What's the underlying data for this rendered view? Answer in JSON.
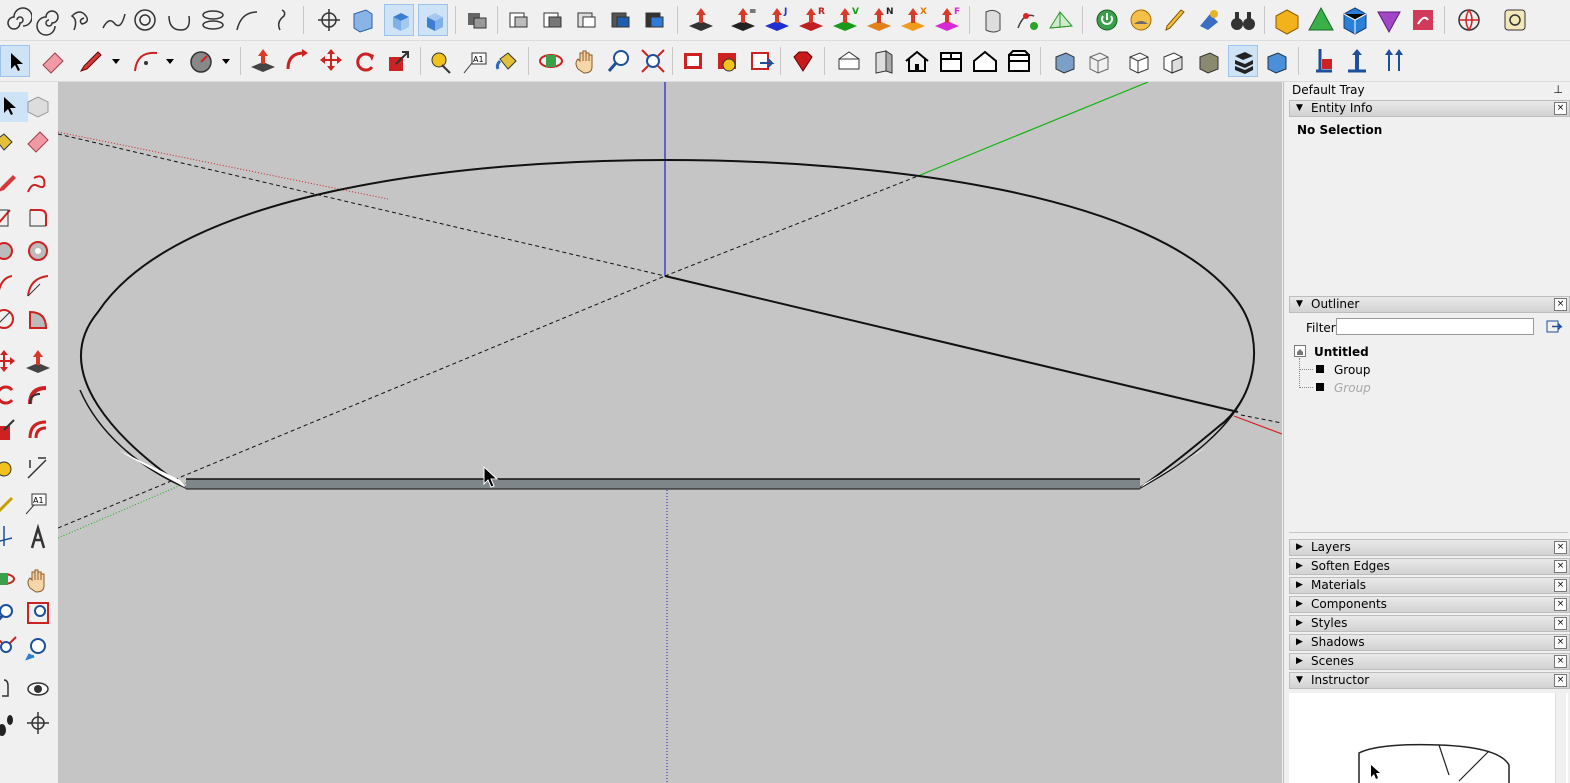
{
  "colors": {
    "viewport_bg": "#c5c5c5",
    "axis_blue": "#1d1dd6",
    "axis_green": "#12b312",
    "axis_red": "#d22020",
    "edge_black": "#111111",
    "face_gray": "#7f868a",
    "tray_bg": "#f0f0f0"
  },
  "toolbar_row1": {
    "icons": [
      "spiral-icon",
      "spiral-icon",
      "spiral-icon",
      "spiral-icon",
      "spiral-icon",
      "spiral-icon",
      "spiral-icon",
      "arc-icon",
      "curve-icon",
      "position-camera-icon",
      "iso-view-icon",
      "top-view-icon",
      "front-view-icon",
      "solid-tools-icon",
      "section-icon",
      "section-icon",
      "section-icon",
      "section-icon",
      "section-icon",
      "push-pull-icon",
      "push-pull-icon",
      "push-pull-icon",
      "push-pull-icon",
      "push-pull-icon",
      "push-pull-icon",
      "push-pull-icon",
      "sandbox-icon",
      "sandbox-icon",
      "sandbox-icon",
      "power-icon",
      "sun-icon",
      "pencil-icon",
      "paint-icon",
      "binoculars-icon",
      "shape-icon",
      "shape-icon",
      "shape-icon",
      "shape-icon",
      "shape-icon",
      "globe-icon",
      "warehouse-icon"
    ],
    "push_pull_letters": [
      "=",
      "J",
      "R",
      "V",
      "N",
      "X",
      "F"
    ]
  },
  "toolbar_row2": {
    "icons": [
      "select-icon",
      "eraser-icon",
      "pencil-icon",
      "arc-icon",
      "circle-icon",
      "push-pull-icon",
      "follow-me-icon",
      "move-icon",
      "rotate-icon",
      "scale-icon",
      "tape-measure-icon",
      "text-icon",
      "paint-bucket-icon",
      "orbit-icon",
      "pan-icon",
      "zoom-icon",
      "zoom-extents-icon",
      "layout-icon",
      "model-info-icon",
      "export-icon",
      "ruby-icon",
      "iso-view-icon",
      "front-view-icon",
      "home-view-icon",
      "top-view-icon",
      "right-view-icon",
      "back-view-icon",
      "xray-icon",
      "wireframe-icon",
      "hidden-line-icon",
      "shaded-icon",
      "textured-icon",
      "monochrome-icon",
      "component-icon",
      "import-icon",
      "upload-icon"
    ],
    "text_tool_label": "A1"
  },
  "left_toolbar": {
    "text_tool_label": "A1"
  },
  "tray": {
    "title": "Default Tray",
    "pin": "⊥",
    "panels_top": [
      {
        "label": "Entity Info",
        "expanded": true
      },
      {
        "label": "Outliner",
        "expanded": true
      }
    ],
    "entity_info": {
      "status": "No Selection"
    },
    "outliner": {
      "filter_label": "Filter:",
      "filter_value": "",
      "root": "Untitled",
      "children": [
        {
          "label": "Group",
          "hidden": false
        },
        {
          "label": "Group",
          "hidden": true
        }
      ]
    },
    "panels_bottom": [
      {
        "label": "Layers",
        "expanded": false
      },
      {
        "label": "Soften Edges",
        "expanded": false
      },
      {
        "label": "Materials",
        "expanded": false
      },
      {
        "label": "Components",
        "expanded": false
      },
      {
        "label": "Styles",
        "expanded": false
      },
      {
        "label": "Shadows",
        "expanded": false
      },
      {
        "label": "Scenes",
        "expanded": false
      },
      {
        "label": "Instructor",
        "expanded": true
      }
    ]
  }
}
